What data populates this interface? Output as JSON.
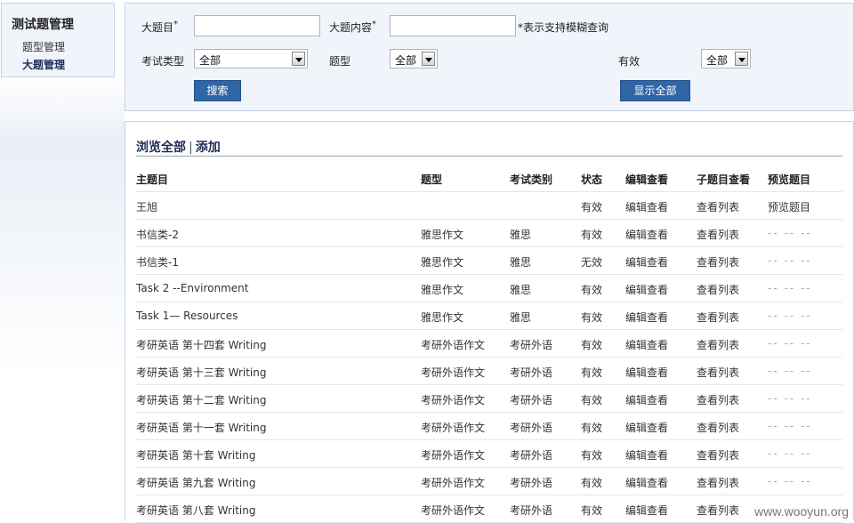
{
  "sidebar": {
    "title": "测试题管理",
    "items": [
      {
        "label": "题型管理"
      },
      {
        "label": "大题管理"
      }
    ]
  },
  "search": {
    "title_label": "大题目",
    "title_value": "",
    "content_label": "大题内容",
    "content_value": "",
    "required_mark": "*",
    "fuzzy_hint": "*表示支持模糊查询",
    "exam_type_label": "考试类型",
    "exam_type_value": "全部",
    "question_type_label": "题型",
    "question_type_value": "全部",
    "valid_label": "有效",
    "valid_value": "全部",
    "search_button": "搜索",
    "show_all_button": "显示全部"
  },
  "list": {
    "browse_all": "浏览全部",
    "separator": "|",
    "add": "添加",
    "columns": [
      "主题目",
      "题型",
      "考试类别",
      "状态",
      "编辑查看",
      "子题目查看",
      "预览题目"
    ],
    "rows": [
      {
        "title": "王旭",
        "type": "",
        "category": "",
        "status": "有效",
        "edit": "编辑查看",
        "sub": "查看列表",
        "preview": "预览题目"
      },
      {
        "title": "书信类-2",
        "type": "雅思作文",
        "category": "雅思",
        "status": "有效",
        "edit": "编辑查看",
        "sub": "查看列表",
        "preview": "-- -- --"
      },
      {
        "title": "书信类-1",
        "type": "雅思作文",
        "category": "雅思",
        "status": "无效",
        "edit": "编辑查看",
        "sub": "查看列表",
        "preview": "-- -- --"
      },
      {
        "title": "Task 2 --Environment",
        "type": "雅思作文",
        "category": "雅思",
        "status": "有效",
        "edit": "编辑查看",
        "sub": "查看列表",
        "preview": "-- -- --"
      },
      {
        "title": "Task 1— Resources",
        "type": "雅思作文",
        "category": "雅思",
        "status": "有效",
        "edit": "编辑查看",
        "sub": "查看列表",
        "preview": "-- -- --"
      },
      {
        "title": "考研英语 第十四套 Writing",
        "type": "考研外语作文",
        "category": "考研外语",
        "status": "有效",
        "edit": "编辑查看",
        "sub": "查看列表",
        "preview": "-- -- --"
      },
      {
        "title": "考研英语 第十三套 Writing",
        "type": "考研外语作文",
        "category": "考研外语",
        "status": "有效",
        "edit": "编辑查看",
        "sub": "查看列表",
        "preview": "-- -- --"
      },
      {
        "title": "考研英语 第十二套 Writing",
        "type": "考研外语作文",
        "category": "考研外语",
        "status": "有效",
        "edit": "编辑查看",
        "sub": "查看列表",
        "preview": "-- -- --"
      },
      {
        "title": "考研英语 第十一套 Writing",
        "type": "考研外语作文",
        "category": "考研外语",
        "status": "有效",
        "edit": "编辑查看",
        "sub": "查看列表",
        "preview": "-- -- --"
      },
      {
        "title": "考研英语 第十套 Writing",
        "type": "考研外语作文",
        "category": "考研外语",
        "status": "有效",
        "edit": "编辑查看",
        "sub": "查看列表",
        "preview": "-- -- --"
      },
      {
        "title": "考研英语 第九套 Writing",
        "type": "考研外语作文",
        "category": "考研外语",
        "status": "有效",
        "edit": "编辑查看",
        "sub": "查看列表",
        "preview": "-- -- --"
      },
      {
        "title": "考研英语 第八套 Writing",
        "type": "考研外语作文",
        "category": "考研外语",
        "status": "有效",
        "edit": "编辑查看",
        "sub": "查看列表",
        "preview": "-- -- --"
      }
    ]
  },
  "watermark": "www.wooyun.org"
}
